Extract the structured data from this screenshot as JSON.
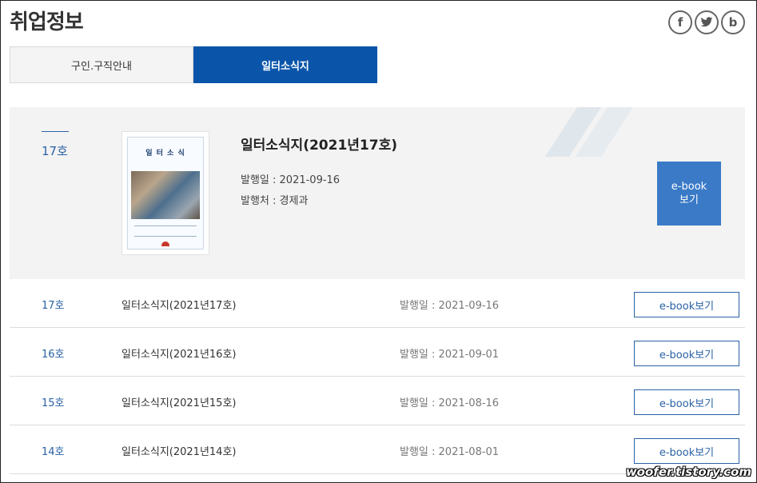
{
  "page": {
    "title": "취업정보"
  },
  "social": [
    {
      "icon": "facebook-icon",
      "glyph": "f"
    },
    {
      "icon": "twitter-icon",
      "glyph": "🐦"
    },
    {
      "icon": "blog-icon",
      "glyph": "b"
    }
  ],
  "tabs": [
    {
      "label": "구인.구직안내",
      "active": false
    },
    {
      "label": "일터소식지",
      "active": true
    }
  ],
  "featured": {
    "issue": "17호",
    "cover_title": "일 터 소 식",
    "title": "일터소식지(2021년17호)",
    "date_line": "발행일 : 2021-09-16",
    "publisher_line": "발행처 : 경제과",
    "ebook_line1": "e-book",
    "ebook_line2": "보기"
  },
  "rows": [
    {
      "issue": "17호",
      "title": "일터소식지(2021년17호)",
      "date": "발행일 : 2021-09-16",
      "button": "e-book보기"
    },
    {
      "issue": "16호",
      "title": "일터소식지(2021년16호)",
      "date": "발행일 : 2021-09-01",
      "button": "e-book보기"
    },
    {
      "issue": "15호",
      "title": "일터소식지(2021년15호)",
      "date": "발행일 : 2021-08-16",
      "button": "e-book보기"
    },
    {
      "issue": "14호",
      "title": "일터소식지(2021년14호)",
      "date": "발행일 : 2021-08-01",
      "button": "e-book보기"
    }
  ],
  "watermark": "woofer.tistory.com",
  "colors": {
    "accent": "#0a55aa",
    "link": "#2a62a5",
    "ebook": "#3a7ac7"
  }
}
